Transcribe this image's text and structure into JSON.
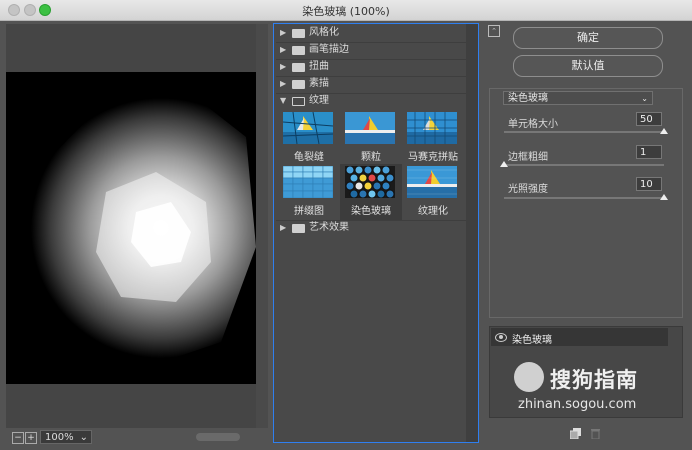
{
  "window": {
    "title": "染色玻璃 (100%)"
  },
  "preview": {
    "zoom": "100%",
    "zoom_out": "−",
    "zoom_in": "+"
  },
  "gallery": {
    "categories": [
      {
        "label": "风格化",
        "expanded": false
      },
      {
        "label": "画笔描边",
        "expanded": false
      },
      {
        "label": "扭曲",
        "expanded": false
      },
      {
        "label": "素描",
        "expanded": false
      },
      {
        "label": "纹理",
        "expanded": true
      },
      {
        "label": "艺术效果",
        "expanded": false
      }
    ],
    "texture_filters": [
      {
        "label": "龟裂缝"
      },
      {
        "label": "颗粒"
      },
      {
        "label": "马赛克拼贴"
      },
      {
        "label": "拼缀图"
      },
      {
        "label": "染色玻璃",
        "selected": true
      },
      {
        "label": "纹理化"
      }
    ]
  },
  "actions": {
    "ok": "确定",
    "default": "默认值"
  },
  "settings": {
    "filter": "染色玻璃",
    "params": [
      {
        "label": "单元格大小",
        "value": "50",
        "fraction": 1.0
      },
      {
        "label": "边框粗细",
        "value": "1",
        "fraction": 0.0
      },
      {
        "label": "光照强度",
        "value": "10",
        "fraction": 1.0
      }
    ]
  },
  "layers": {
    "items": [
      {
        "label": "染色玻璃"
      }
    ]
  },
  "watermark": {
    "brand": "搜狗指南",
    "url": "zhinan.sogou.com"
  },
  "colors": {
    "accent": "#2f7ff0",
    "panel": "#535353"
  }
}
